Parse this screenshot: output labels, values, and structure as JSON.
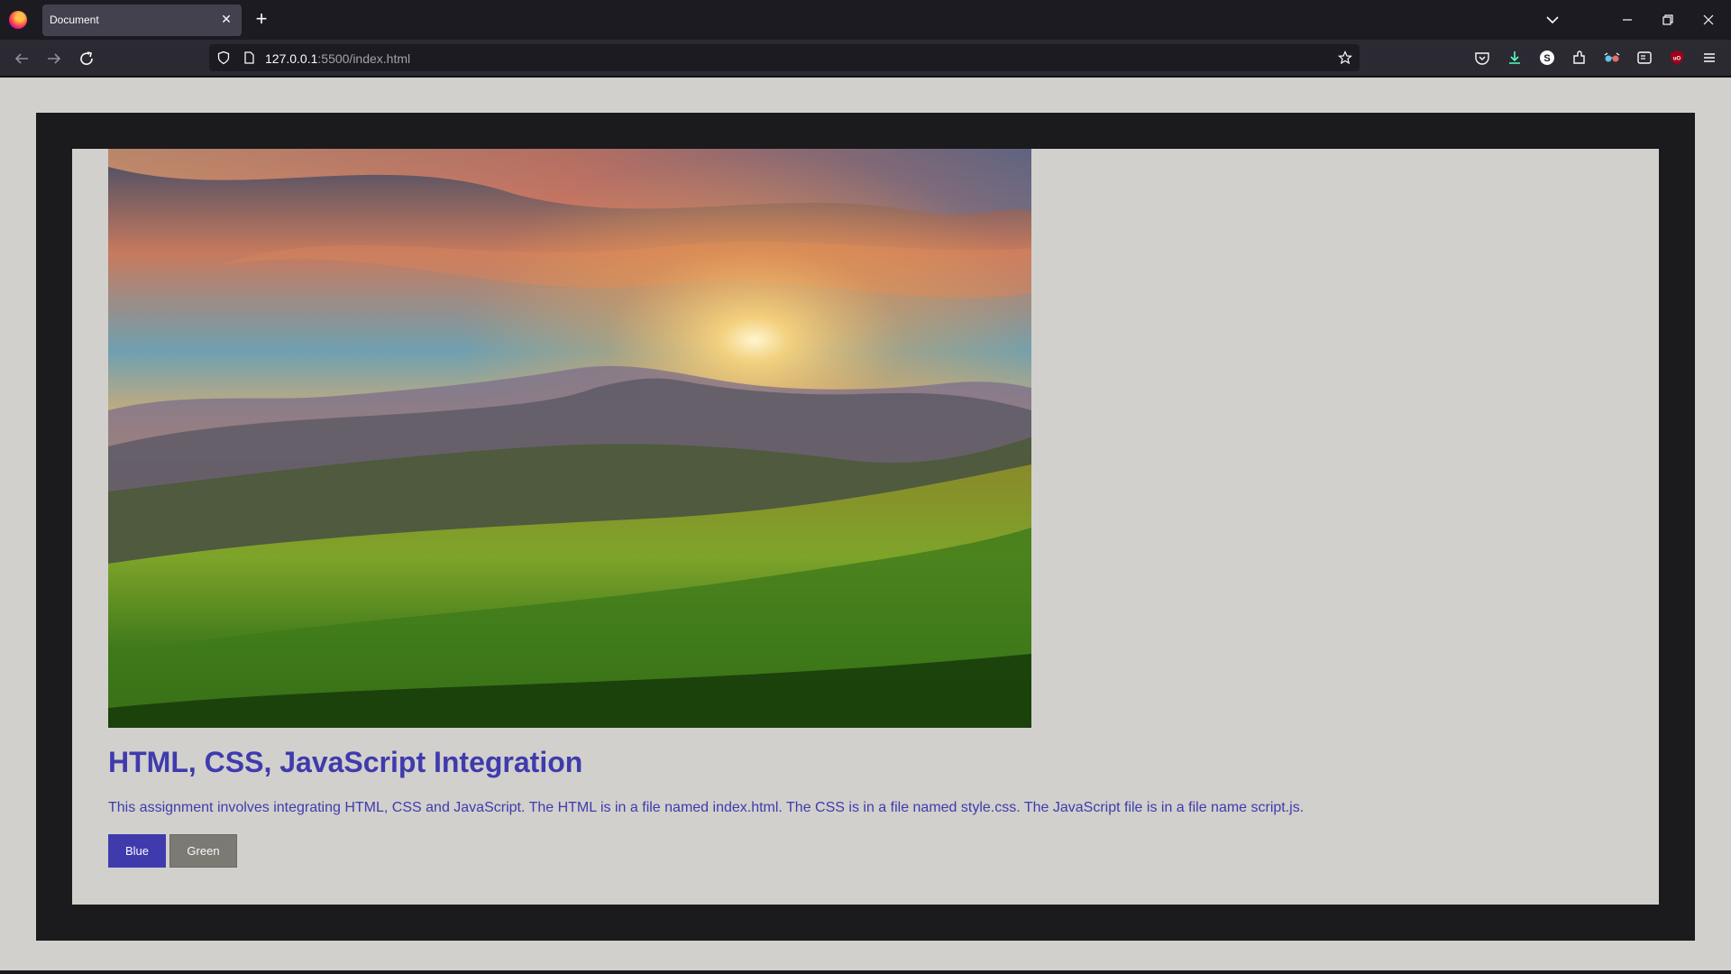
{
  "browser": {
    "tab_title": "Document",
    "url_host": "127.0.0.1",
    "url_rest": ":5500/index.html"
  },
  "page": {
    "title": "HTML, CSS, JavaScript Integration",
    "text": "This assignment involves integrating HTML, CSS and JavaScript. The HTML is in a file named index.html. The CSS is in a file named style.css. The JavaScript file is in a file name script.js.",
    "buttons": {
      "blue": "Blue",
      "green": "Green"
    },
    "image": "mountain-sunset-meadow"
  },
  "colors": {
    "accent": "#3f3bad",
    "page_bg": "#d1d0cc",
    "frame": "#1b1a1d",
    "green_button": "#7b7a73"
  }
}
